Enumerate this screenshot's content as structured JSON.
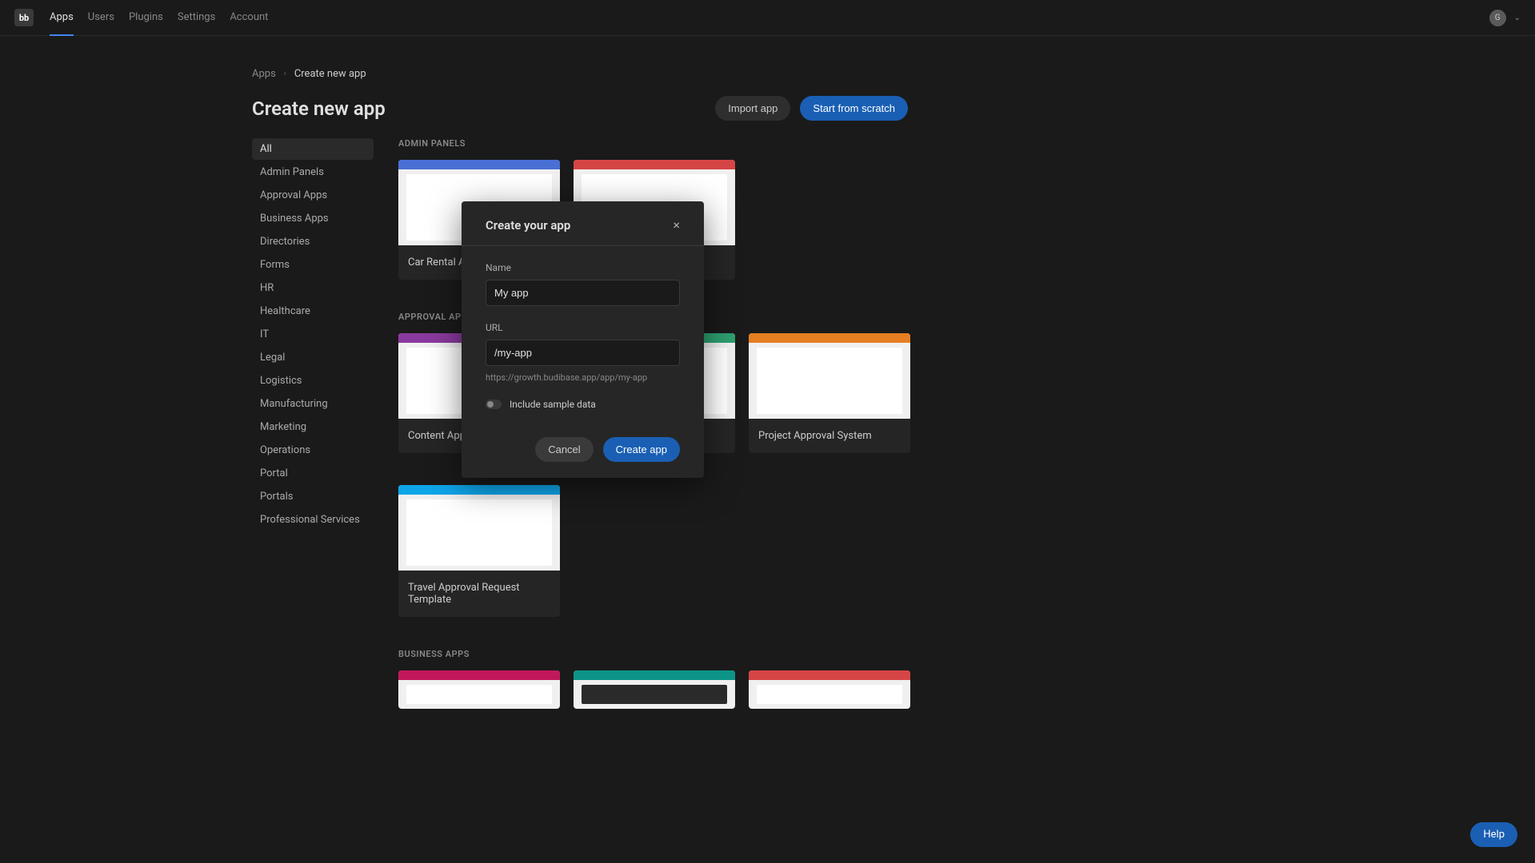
{
  "nav": {
    "logo": "bb",
    "items": [
      "Apps",
      "Users",
      "Plugins",
      "Settings",
      "Account"
    ],
    "avatar_initial": "G"
  },
  "breadcrumb": {
    "link": "Apps",
    "current": "Create new app"
  },
  "page": {
    "title": "Create new app",
    "import_label": "Import app",
    "scratch_label": "Start from scratch"
  },
  "sidebar": {
    "items": [
      "All",
      "Admin Panels",
      "Approval Apps",
      "Business Apps",
      "Directories",
      "Forms",
      "HR",
      "Healthcare",
      "IT",
      "Legal",
      "Logistics",
      "Manufacturing",
      "Marketing",
      "Operations",
      "Portal",
      "Portals",
      "Professional Services"
    ]
  },
  "sections": {
    "admin_panels": {
      "title": "ADMIN PANELS",
      "cards": [
        {
          "title": "Car Rental Admin"
        }
      ]
    },
    "approval_apps": {
      "title": "APPROVAL APPS",
      "cards": [
        {
          "title": "Content Approval"
        },
        {
          "title": ""
        },
        {
          "title": "Project Approval System"
        },
        {
          "title": "Travel Approval Request Template"
        }
      ]
    },
    "business_apps": {
      "title": "BUSINESS APPS"
    }
  },
  "modal": {
    "title": "Create your app",
    "name_label": "Name",
    "name_value": "My app",
    "url_label": "URL",
    "url_value": "/my-app",
    "url_hint": "https://growth.budibase.app/app/my-app",
    "toggle_label": "Include sample data",
    "cancel_label": "Cancel",
    "create_label": "Create app"
  },
  "help": {
    "label": "Help"
  }
}
